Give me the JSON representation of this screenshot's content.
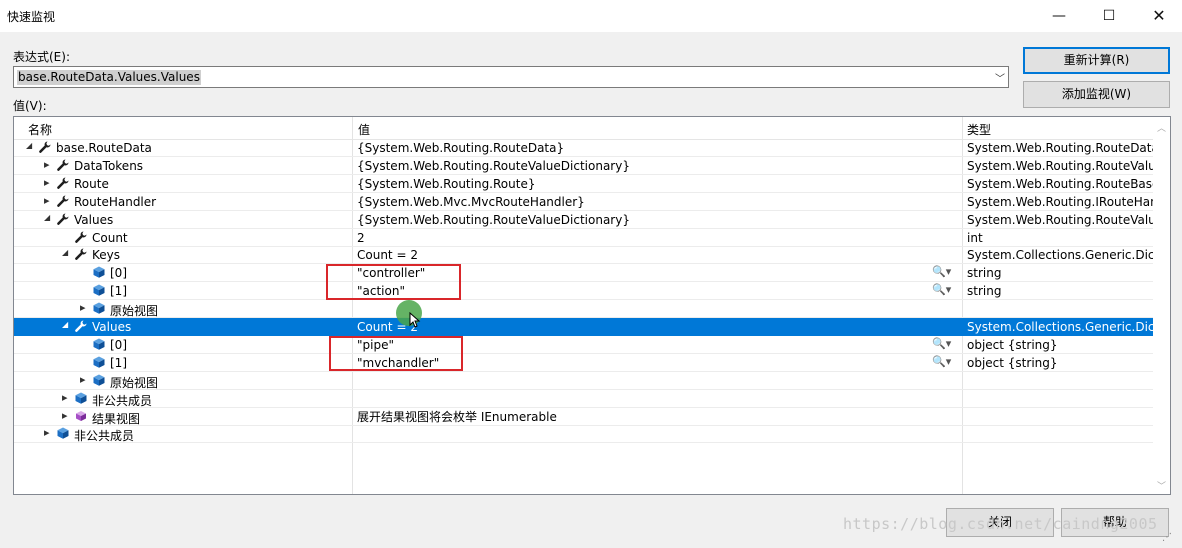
{
  "window": {
    "title": "快速监视",
    "min": "—",
    "max": "☐",
    "close": "✕"
  },
  "expression_label": "表达式(E):",
  "expression_value": "base.RouteData.Values.Values",
  "value_label": "值(V):",
  "buttons": {
    "recalc": "重新计算(R)",
    "add_watch": "添加监视(W)",
    "close": "关闭",
    "help": "帮助"
  },
  "columns": {
    "name": "名称",
    "value": "值",
    "type": "类型"
  },
  "rows": [
    {
      "name": "base.RouteData",
      "value": "{System.Web.Routing.RouteData}",
      "type": "System.Web.Routing.RouteData"
    },
    {
      "name": "DataTokens",
      "value": "{System.Web.Routing.RouteValueDictionary}",
      "type": "System.Web.Routing.RouteValueD"
    },
    {
      "name": "Route",
      "value": "{System.Web.Routing.Route}",
      "type": "System.Web.Routing.RouteBase {"
    },
    {
      "name": "RouteHandler",
      "value": "{System.Web.Mvc.MvcRouteHandler}",
      "type": "System.Web.Routing.IRouteHand"
    },
    {
      "name": "Values",
      "value": "{System.Web.Routing.RouteValueDictionary}",
      "type": "System.Web.Routing.RouteValueD"
    },
    {
      "name": "Count",
      "value": "2",
      "type": "int"
    },
    {
      "name": "Keys",
      "value": "Count = 2",
      "type": "System.Collections.Generic.Dictio"
    },
    {
      "name": "[0]",
      "value": "\"controller\"",
      "type": "string"
    },
    {
      "name": "[1]",
      "value": "\"action\"",
      "type": "string"
    },
    {
      "name": "原始视图",
      "value": "",
      "type": ""
    },
    {
      "name": "Values",
      "value": "Count = 2",
      "type": "System.Collections.Generic.Dictio"
    },
    {
      "name": "[0]",
      "value": "\"pipe\"",
      "type": "object {string}"
    },
    {
      "name": "[1]",
      "value": "\"mvchandler\"",
      "type": "object {string}"
    },
    {
      "name": "原始视图",
      "value": "",
      "type": ""
    },
    {
      "name": "非公共成员",
      "value": "",
      "type": ""
    },
    {
      "name": "结果视图",
      "value": "展开结果视图将会枚举 IEnumerable",
      "type": ""
    },
    {
      "name": "非公共成员",
      "value": "",
      "type": ""
    }
  ],
  "watermark": "https://blog.csdn.net/caindng2005",
  "colors": {
    "selection": "#0078d7",
    "highlight_box": "#d9262a",
    "cursor": "#4aa64a"
  }
}
